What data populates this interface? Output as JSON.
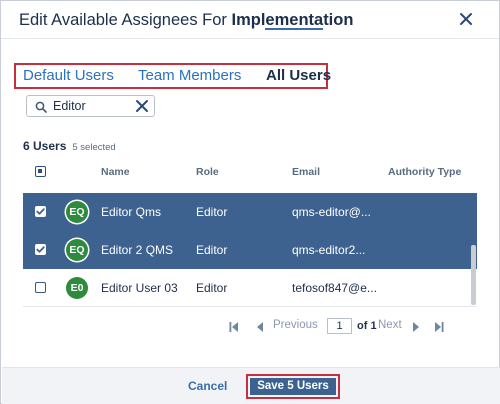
{
  "dialog": {
    "title_prefix": "Edit Available Assignees For ",
    "title_strong": "Implementation",
    "close_icon": "close-icon"
  },
  "tabs": [
    {
      "label": "Default Users",
      "active": false
    },
    {
      "label": "Team Members",
      "active": false
    },
    {
      "label": "All Users",
      "active": true
    }
  ],
  "search": {
    "value": "Editor",
    "icon": "search-icon",
    "clear_icon": "clear-icon"
  },
  "summary": {
    "count": "6 Users",
    "selected": "5 selected"
  },
  "table": {
    "columns": [
      "Name",
      "Role",
      "Email",
      "Authority Type"
    ],
    "rows": [
      {
        "initials": "EQ",
        "name": "Editor Qms",
        "role": "Editor",
        "email": "qms-editor@...",
        "checked": true,
        "selected": true
      },
      {
        "initials": "EQ",
        "name": "Editor 2 QMS",
        "role": "Editor",
        "email": "qms-editor2...",
        "checked": true,
        "selected": true
      },
      {
        "initials": "E0",
        "name": "Editor User 03",
        "role": "Editor",
        "email": "tefosof847@e...",
        "checked": false,
        "selected": false
      }
    ]
  },
  "pagination": {
    "previous_label": "Previous",
    "page": "1",
    "of_label": "of 1",
    "next_label": "Next",
    "icons": [
      "first-page-icon",
      "previous-page-icon",
      "next-page-icon",
      "last-page-icon"
    ]
  },
  "footer": {
    "cancel_label": "Cancel",
    "save_label": "Save 5 Users"
  },
  "colors": {
    "accent": "#3e628f",
    "link": "#2a72c2",
    "highlight_border": "#c6303e",
    "avatar": "#2e8b3e"
  }
}
